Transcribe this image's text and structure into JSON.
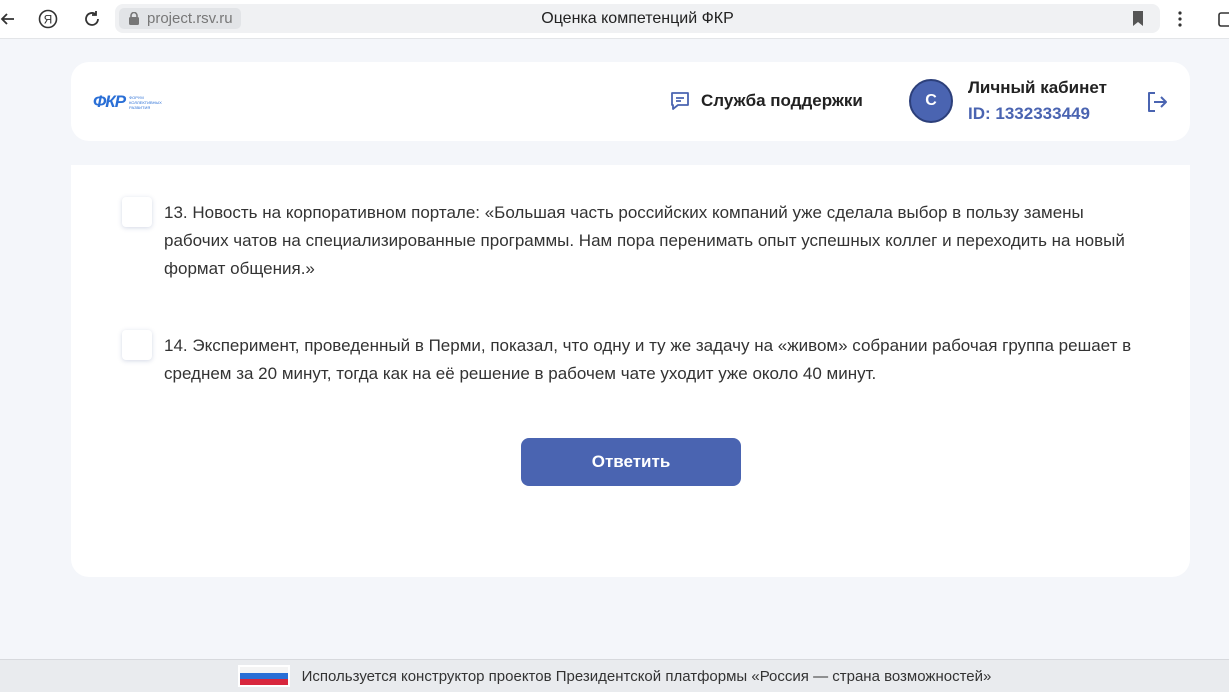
{
  "browser": {
    "url": "project.rsv.ru",
    "title": "Оценка компетенций ФКР"
  },
  "header": {
    "logo_text": "ФКР",
    "logo_subtitle": "ФОРУМ КОЛЛЕКТИВНЫХ РАЗВИТИЯ",
    "support_label": "Служба поддержки",
    "avatar_initial": "С",
    "cabinet_title": "Личный кабинет",
    "cabinet_id": "ID: 1332333449"
  },
  "options": [
    {
      "text": "13. Новость на корпоративном портале: «Большая часть российских компаний уже сделала выбор в пользу замены рабочих чатов на специализированные программы. Нам пора перенимать опыт успешных коллег и переходить на новый формат общения.»",
      "checked": false
    },
    {
      "text": "14. Эксперимент, проведенный в Перми, показал, что одну и ту же задачу на «живом» собрании рабочая группа решает в среднем за 20 минут, тогда как на её решение в рабочем чате уходит уже около 40 минут.",
      "checked": false
    }
  ],
  "submit_label": "Ответить",
  "footer": {
    "logo_text": "РОССИЯ СТРАНА ВОЗМОЖНОСТЕЙ",
    "text": "Используется конструктор проектов Президентской платформы «Россия — страна возможностей»"
  },
  "colors": {
    "accent": "#4a64b1",
    "logo_blue": "#2a6fd6",
    "page_bg": "#f4f6fa"
  }
}
